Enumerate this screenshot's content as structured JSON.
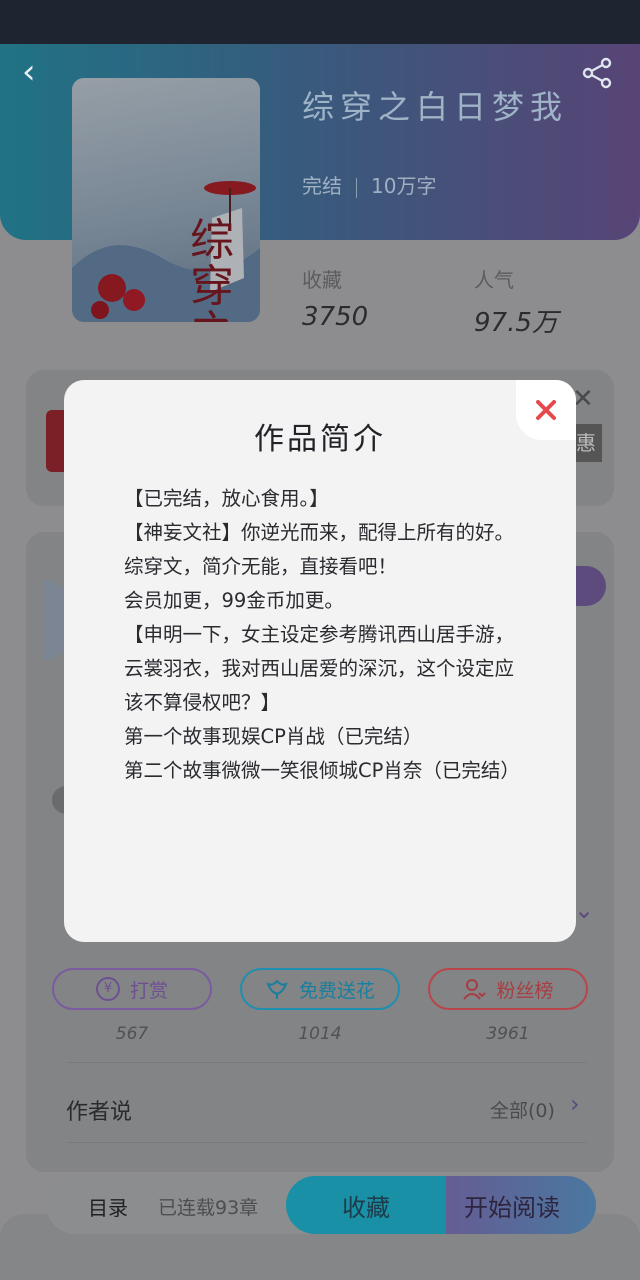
{
  "book": {
    "title": "综穿之白日梦我",
    "status": "完结",
    "word_count": "10万字",
    "cover_title": "综穿之白日梦我"
  },
  "stats": {
    "collect_label": "收藏",
    "collect_value": "3750",
    "popularity_label": "人气",
    "popularity_value": "97.5万"
  },
  "behind": {
    "tag_text": "惠"
  },
  "actions": [
    {
      "label": "打赏",
      "count": "567",
      "color": "#7a5aa0"
    },
    {
      "label": "免费送花",
      "count": "1014",
      "color": "#1e8fb0"
    },
    {
      "label": "粉丝榜",
      "count": "3961",
      "color": "#b9454a"
    }
  ],
  "author": {
    "section_title": "作者说",
    "all_label": "全部(0)"
  },
  "bottom": {
    "toc_label": "目录",
    "toc_status": "已连载93章",
    "collect_button": "收藏",
    "read_button": "开始阅读"
  },
  "modal": {
    "title": "作品简介",
    "paragraphs": [
      "【已完结，放心食用。】",
      "【神妄文社】你逆光而来，配得上所有的好。",
      "综穿文，简介无能，直接看吧！",
      "会员加更，99金币加更。",
      "【申明一下，女主设定参考腾讯西山居手游，云裳羽衣，我对西山居爱的深沉，这个设定应该不算侵权吧？】",
      "第一个故事现娱CP肖战（已完结）",
      "第二个故事微微一笑很倾城CP肖奈（已完结）"
    ]
  },
  "colors": {
    "accent_red": "#e5484d",
    "gradient_teal": "#2d9fb8",
    "gradient_purple": "#7a5fa4"
  }
}
